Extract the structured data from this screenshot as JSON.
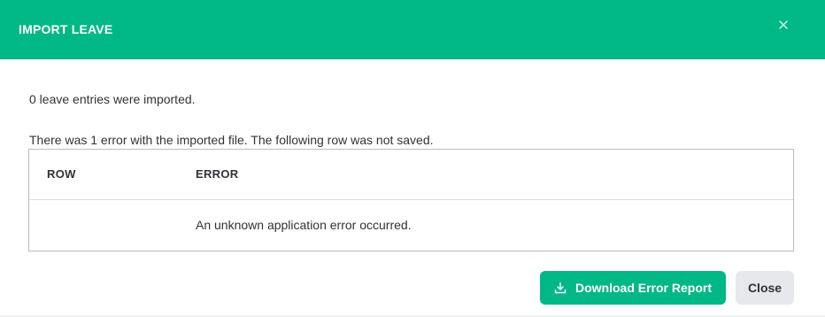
{
  "modal": {
    "title": "IMPORT LEAVE",
    "close_icon": "close-icon",
    "summary": "0 leave entries were imported.",
    "error_message": "There was 1 error with the imported file. The following row was not saved."
  },
  "table": {
    "columns": [
      "ROW",
      "ERROR"
    ],
    "rows": [
      {
        "row": "",
        "error": "An unknown application error occurred."
      }
    ]
  },
  "actions": {
    "download_label": "Download Error Report",
    "download_icon": "download-icon",
    "close_label": "Close"
  },
  "colors": {
    "accent": "#00b885",
    "secondary_button": "#e6e8eb",
    "text": "#2f3338",
    "border": "#b8bcc2"
  }
}
